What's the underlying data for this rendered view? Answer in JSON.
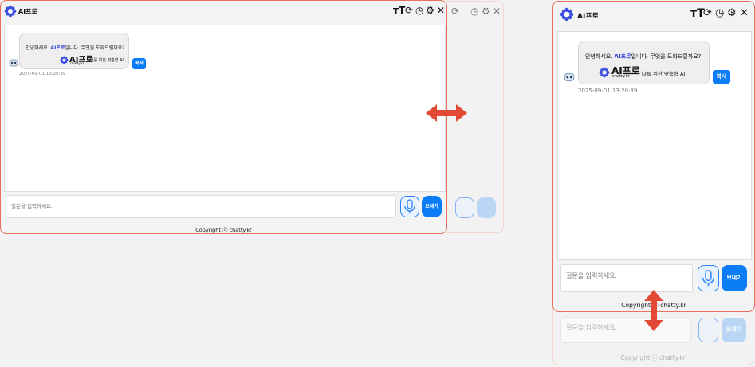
{
  "app": {
    "brand": "AI프로"
  },
  "toolbar": {
    "font_size_label": "ᴛT"
  },
  "message": {
    "greeting_prefix": "안녕하세요. ",
    "greeting_brand": "AI프로",
    "greeting_suffix": "입니다. 무엇을 도와드릴까요?",
    "logo_text": "AI프로",
    "logo_subtext": "chatty.kr",
    "tagline": "나를 위한 맞춤형 AI",
    "timestamp": "2025-09-01 13:20:39",
    "copy_label": "복사"
  },
  "input": {
    "placeholder": "질문을 입력하세요."
  },
  "send_label": "보내기",
  "footer": {
    "copyright": "Copyright ⓒ chatty.kr"
  },
  "colors": {
    "accent": "#0a7cf5",
    "frame": "#e8705c",
    "arrow": "#e24a35",
    "brand_text": "#2d3fd8"
  }
}
